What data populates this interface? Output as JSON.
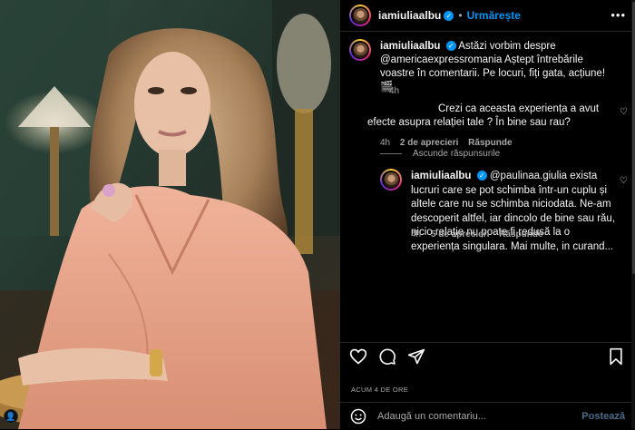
{
  "header": {
    "username": "iamiuliaalbu",
    "separator": "•",
    "follow_label": "Urmărește",
    "more_label": "•••"
  },
  "caption": {
    "username": "iamiuliaalbu",
    "text": "Astăzi vorbim despre @americaexpressromania Aștept întrebările voastre în comentarii. Pe locuri, fiți gata, acțiune! 🎬",
    "time": "4h"
  },
  "comments": [
    {
      "text": "Crezi ca aceasta experiența a avut efecte asupra relației tale ? În bine sau rau?",
      "time": "4h",
      "likes_label": "2 de aprecieri",
      "reply_label": "Răspunde"
    }
  ],
  "hide_replies_label": "Ascunde răspunsurile",
  "reply": {
    "username": "iamiuliaalbu",
    "text": "@paulinaa.giulia exista lucruri care se pot schimba într-un cuplu și altele care nu se schimba niciodata. Ne-am descoperit altfel, iar dincolo de bine sau rău, nicio relație nu poate fi redusă la o experiența singulara. Mai multe, in curand...",
    "time": "4h",
    "likes_label": "5 de aprecieri",
    "reply_label": "Răspunde"
  },
  "actions": {
    "timestamp": "ACUM 4 DE ORE"
  },
  "add_comment": {
    "placeholder": "Adaugă un comentariu...",
    "post_label": "Postează"
  },
  "media": {
    "corner_icon": "person-icon",
    "corner_glyph": "👤"
  },
  "colors": {
    "accent": "#0095f6",
    "background": "#000000",
    "muted_text": "#a8a8a8"
  }
}
